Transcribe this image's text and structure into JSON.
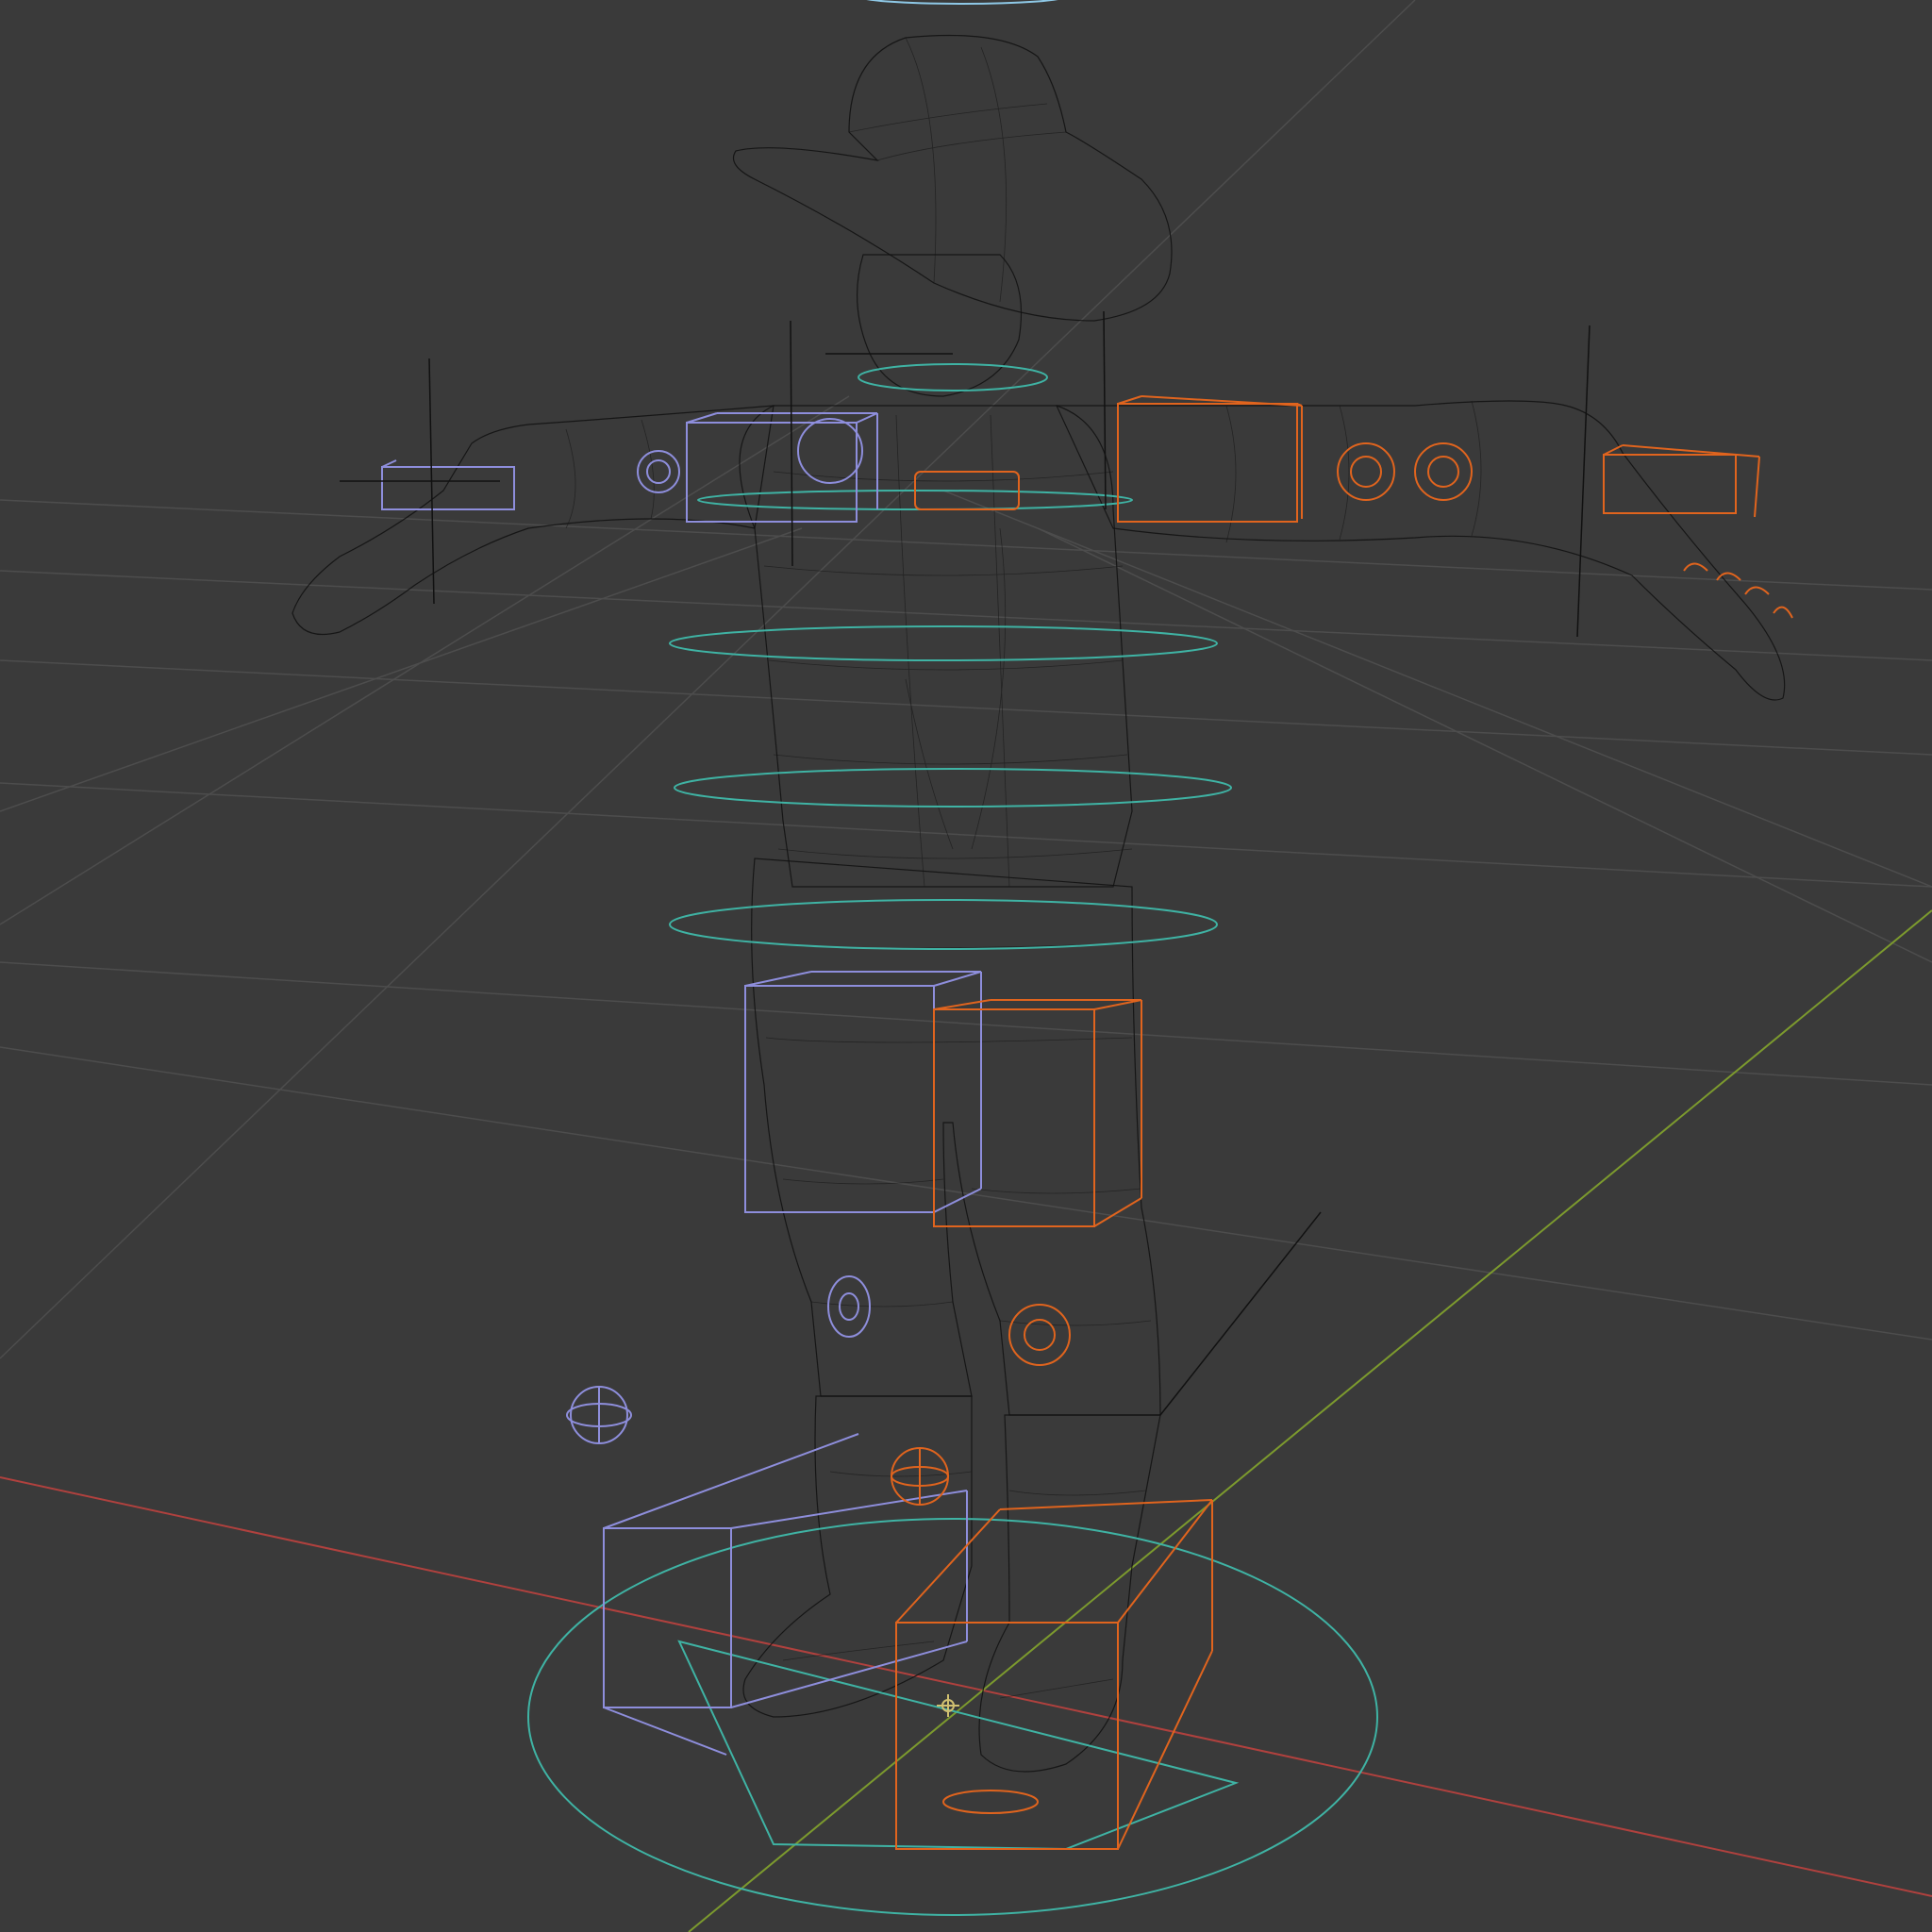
{
  "viewport": {
    "background": "#3a3a3a",
    "shading_mode": "wireframe",
    "view": "perspective"
  },
  "axes": {
    "x_axis_color": "#b0413e",
    "y_axis_color": "#7c9a2e"
  },
  "rig": {
    "mesh_color": "#101010",
    "left_controls_color": "#8e8edc",
    "right_controls_color": "#e0641e",
    "center_controls_color": "#3fb3a4"
  },
  "scene_objects": [
    "cowboy-mesh",
    "hat-mesh",
    "armature-controls",
    "empties"
  ]
}
